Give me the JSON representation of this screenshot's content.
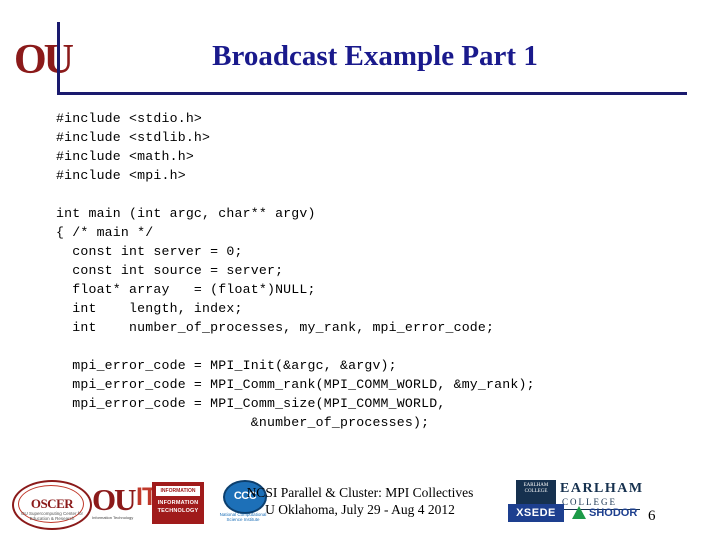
{
  "slide": {
    "title": "Broadcast Example Part 1",
    "number": "6",
    "title_color": "#1a1a8c",
    "rule_color": "#1a1a6e"
  },
  "header": {
    "logo_text": "OU"
  },
  "code": "#include <stdio.h>\n#include <stdlib.h>\n#include <math.h>\n#include <mpi.h>\n\nint main (int argc, char** argv)\n{ /* main */\n  const int server = 0;\n  const int source = server;\n  float* array   = (float*)NULL;\n  int    length, index;\n  int    number_of_processes, my_rank, mpi_error_code;\n\n  mpi_error_code = MPI_Init(&argc, &argv);\n  mpi_error_code = MPI_Comm_rank(MPI_COMM_WORLD, &my_rank);\n  mpi_error_code = MPI_Comm_size(MPI_COMM_WORLD,\n                        &number_of_processes);",
  "footer": {
    "line1": "NCSI Parallel & Cluster: MPI Collectives",
    "line2": "U Oklahoma, July 29 - Aug 4 2012",
    "logos": {
      "oscer": {
        "name": "OSCER",
        "sub": "OU Supercomputing Center for Education & Research"
      },
      "ou": {
        "name": "OU",
        "it": "IT",
        "tagline": "Information Technology"
      },
      "infotech": {
        "bar": "INFORMATION",
        "line1": "INFORMATION",
        "line2": "TECHNOLOGY"
      },
      "ncsi": {
        "name": "CCC",
        "caption": "National Computational Science Institute"
      },
      "earlham": {
        "seal": "EARLHAM COLLEGE",
        "name": "EARLHAM",
        "sub": "COLLEGE"
      },
      "xsede": {
        "name": "XSEDE"
      },
      "shodor": {
        "name": "SHODOR"
      }
    }
  }
}
